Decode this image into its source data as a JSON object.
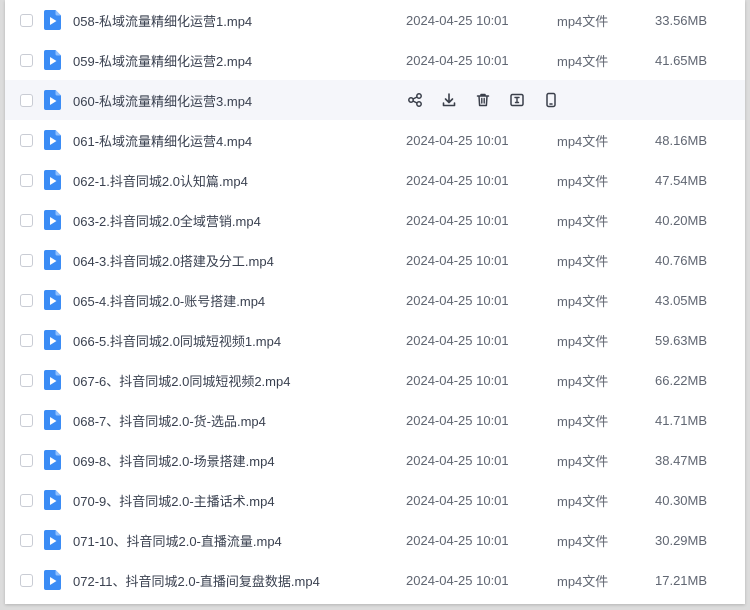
{
  "files": [
    {
      "name": "058-私域流量精细化运营1.mp4",
      "date": "2024-04-25 10:01",
      "type": "mp4文件",
      "size": "33.56MB",
      "hovered": false
    },
    {
      "name": "059-私域流量精细化运营2.mp4",
      "date": "2024-04-25 10:01",
      "type": "mp4文件",
      "size": "41.65MB",
      "hovered": false
    },
    {
      "name": "060-私域流量精细化运营3.mp4",
      "date": "",
      "type": "",
      "size": "",
      "hovered": true
    },
    {
      "name": "061-私域流量精细化运营4.mp4",
      "date": "2024-04-25 10:01",
      "type": "mp4文件",
      "size": "48.16MB",
      "hovered": false
    },
    {
      "name": "062-1.抖音同城2.0认知篇.mp4",
      "date": "2024-04-25 10:01",
      "type": "mp4文件",
      "size": "47.54MB",
      "hovered": false
    },
    {
      "name": "063-2.抖音同城2.0全域营销.mp4",
      "date": "2024-04-25 10:01",
      "type": "mp4文件",
      "size": "40.20MB",
      "hovered": false
    },
    {
      "name": "064-3.抖音同城2.0搭建及分工.mp4",
      "date": "2024-04-25 10:01",
      "type": "mp4文件",
      "size": "40.76MB",
      "hovered": false
    },
    {
      "name": "065-4.抖音同城2.0-账号搭建.mp4",
      "date": "2024-04-25 10:01",
      "type": "mp4文件",
      "size": "43.05MB",
      "hovered": false
    },
    {
      "name": "066-5.抖音同城2.0同城短视频1.mp4",
      "date": "2024-04-25 10:01",
      "type": "mp4文件",
      "size": "59.63MB",
      "hovered": false
    },
    {
      "name": "067-6、抖音同城2.0同城短视频2.mp4",
      "date": "2024-04-25 10:01",
      "type": "mp4文件",
      "size": "66.22MB",
      "hovered": false
    },
    {
      "name": "068-7、抖音同城2.0-货-选品.mp4",
      "date": "2024-04-25 10:01",
      "type": "mp4文件",
      "size": "41.71MB",
      "hovered": false
    },
    {
      "name": "069-8、抖音同城2.0-场景搭建.mp4",
      "date": "2024-04-25 10:01",
      "type": "mp4文件",
      "size": "38.47MB",
      "hovered": false
    },
    {
      "name": "070-9、抖音同城2.0-主播话术.mp4",
      "date": "2024-04-25 10:01",
      "type": "mp4文件",
      "size": "40.30MB",
      "hovered": false
    },
    {
      "name": "071-10、抖音同城2.0-直播流量.mp4",
      "date": "2024-04-25 10:01",
      "type": "mp4文件",
      "size": "30.29MB",
      "hovered": false
    },
    {
      "name": "072-11、抖音同城2.0-直播间复盘数据.mp4",
      "date": "2024-04-25 10:01",
      "type": "mp4文件",
      "size": "17.21MB",
      "hovered": false
    }
  ],
  "hover_actions": [
    "share-icon",
    "download-icon",
    "delete-icon",
    "rename-icon",
    "phone-icon"
  ],
  "colors": {
    "file_icon": "#3b8cf5",
    "hover_row": "#f5f6fa",
    "action_icon": "#3a3f4a"
  }
}
